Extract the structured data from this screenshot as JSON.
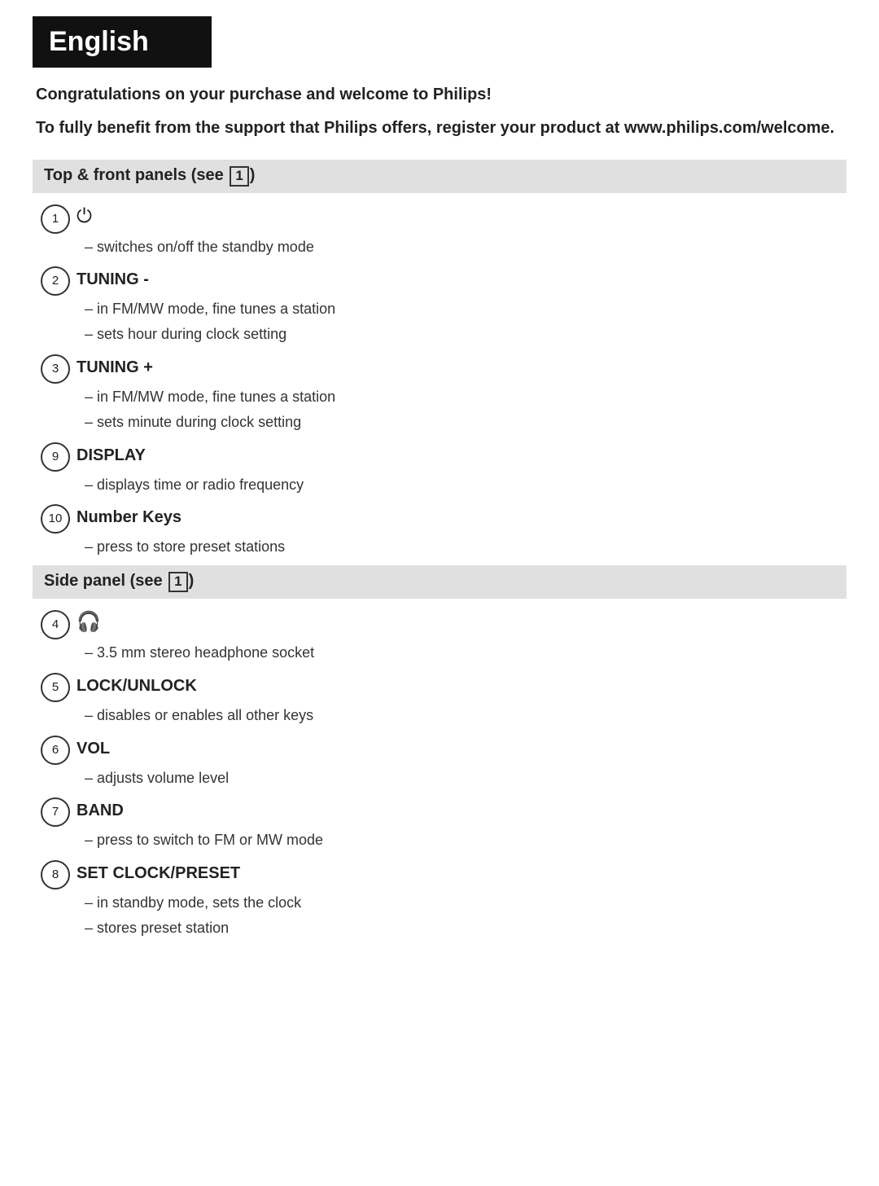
{
  "language": {
    "title": "English"
  },
  "intro": {
    "congrats": "Congratulations on your purchase and welcome to Philips!",
    "register": "To fully benefit from the support that Philips offers, register your product at www.philips.com/welcome."
  },
  "sections": [
    {
      "id": "top-front",
      "title": "Top & front panels (see",
      "ref": "1",
      "items": [
        {
          "number": "1",
          "label_icon": "⏻",
          "label_text": "",
          "is_bold": false,
          "descriptions": [
            "– switches on/off the standby mode"
          ]
        },
        {
          "number": "2",
          "label_icon": "",
          "label_text": "TUNING -",
          "is_bold": true,
          "descriptions": [
            "– in FM/MW mode, fine tunes a station",
            "– sets hour during clock setting"
          ]
        },
        {
          "number": "3",
          "label_icon": "",
          "label_text": "TUNING +",
          "is_bold": true,
          "descriptions": [
            "– in FM/MW mode, fine tunes a station",
            "– sets minute during clock setting"
          ]
        },
        {
          "number": "9",
          "label_icon": "",
          "label_text": "DISPLAY",
          "is_bold": true,
          "descriptions": [
            "– displays time or radio frequency"
          ]
        },
        {
          "number": "10",
          "label_icon": "",
          "label_text": "Number Keys",
          "is_bold": true,
          "descriptions": [
            "– press to store preset stations"
          ]
        }
      ]
    },
    {
      "id": "side-panel",
      "title": "Side panel (see",
      "ref": "1",
      "items": [
        {
          "number": "4",
          "label_icon": "🎧",
          "label_text": "",
          "is_bold": false,
          "descriptions": [
            "– 3.5 mm stereo headphone socket"
          ]
        },
        {
          "number": "5",
          "label_icon": "",
          "label_text": "LOCK/UNLOCK",
          "is_bold": true,
          "descriptions": [
            "– disables or enables all other keys"
          ]
        },
        {
          "number": "6",
          "label_icon": "",
          "label_text": "VOL",
          "is_bold": true,
          "descriptions": [
            "– adjusts volume level"
          ]
        },
        {
          "number": "7",
          "label_icon": "",
          "label_text": "BAND",
          "is_bold": true,
          "descriptions": [
            "– press to switch to FM or MW mode"
          ]
        },
        {
          "number": "8",
          "label_icon": "",
          "label_text": "SET CLOCK/PRESET",
          "is_bold": true,
          "descriptions": [
            "– in standby mode, sets the clock",
            "– stores preset station"
          ]
        }
      ]
    }
  ]
}
